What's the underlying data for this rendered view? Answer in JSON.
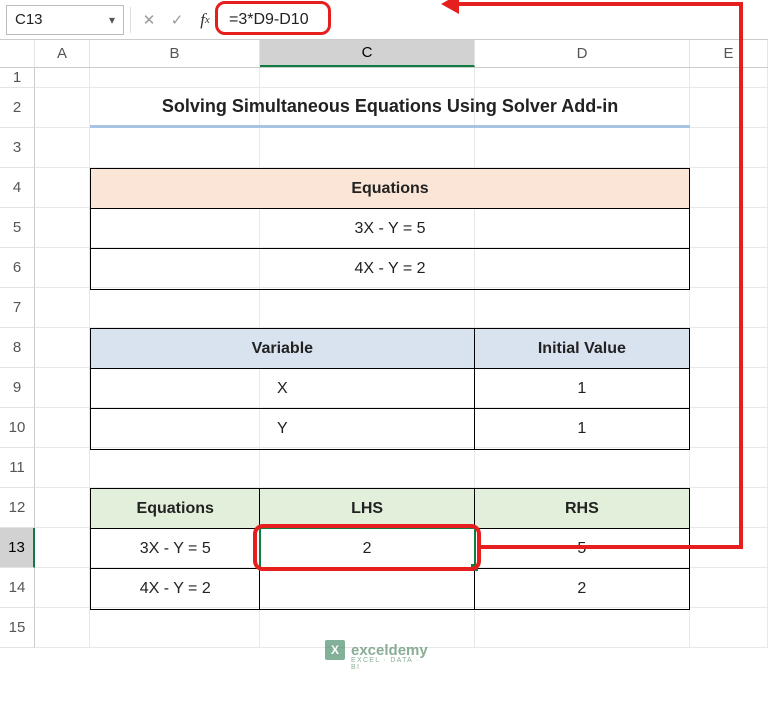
{
  "nameBox": "C13",
  "formulaBar": "=3*D9-D10",
  "columns": [
    "",
    "A",
    "B",
    "C",
    "D",
    "E"
  ],
  "selectedCol": "C",
  "rows": [
    "1",
    "2",
    "3",
    "4",
    "5",
    "6",
    "7",
    "8",
    "9",
    "10",
    "11",
    "12",
    "13",
    "14",
    "15"
  ],
  "selectedRow": "13",
  "title": "Solving Simultaneous Equations Using Solver Add-in",
  "equations": {
    "header": "Equations",
    "rows": [
      "3X - Y = 5",
      "4X - Y = 2"
    ]
  },
  "variables": {
    "headers": [
      "Variable",
      "Initial Value"
    ],
    "rows": [
      {
        "name": "X",
        "value": "1"
      },
      {
        "name": "Y",
        "value": "1"
      }
    ]
  },
  "solver": {
    "headers": [
      "Equations",
      "LHS",
      "RHS"
    ],
    "rows": [
      {
        "eq": "3X - Y = 5",
        "lhs": "2",
        "rhs": "5"
      },
      {
        "eq": "4X - Y = 2",
        "lhs": "",
        "rhs": "2"
      }
    ]
  },
  "watermark": {
    "brand": "exceldemy",
    "tag": "EXCEL · DATA · BI"
  },
  "chart_data": {
    "type": "table",
    "title": "Solving Simultaneous Equations Using Solver Add-in",
    "series": [
      {
        "name": "Equations",
        "values": [
          "3X - Y = 5",
          "4X - Y = 2"
        ]
      },
      {
        "name": "Variable initial values",
        "categories": [
          "X",
          "Y"
        ],
        "values": [
          1,
          1
        ]
      },
      {
        "name": "LHS",
        "categories": [
          "3X-Y=5",
          "4X-Y=2"
        ],
        "values": [
          2,
          null
        ]
      },
      {
        "name": "RHS",
        "categories": [
          "3X-Y=5",
          "4X-Y=2"
        ],
        "values": [
          5,
          2
        ]
      }
    ]
  }
}
